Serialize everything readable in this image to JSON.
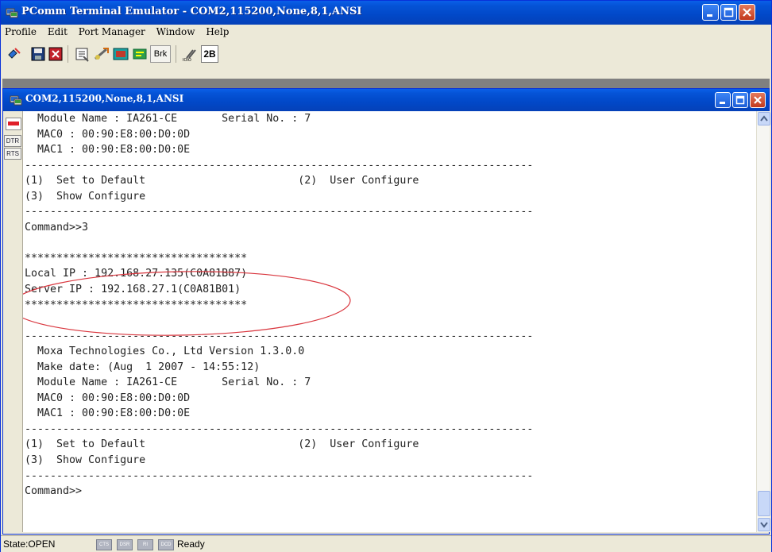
{
  "window": {
    "title": "PComm Terminal Emulator - COM2,115200,None,8,1,ANSI"
  },
  "menu": [
    "Profile",
    "Edit",
    "Port Manager",
    "Window",
    "Help"
  ],
  "toolbar": {
    "icons": [
      "connect-icon",
      "save-icon",
      "capture-icon",
      "properties-icon",
      "send-file-icon",
      "receive-file-icon",
      "scroll-icon"
    ],
    "brk_label": "Brk",
    "twob_label": "2B"
  },
  "child": {
    "title": "COM2,115200,None,8,1,ANSI"
  },
  "side": {
    "dtr_label": "DTR",
    "rts_label": "RTS"
  },
  "terminal": {
    "lines": [
      "  Module Name : IA261-CE       Serial No. : 7",
      "  MAC0 : 00:90:E8:00:D0:0D",
      "  MAC1 : 00:90:E8:00:D0:0E",
      "--------------------------------------------------------------------------------",
      "(1)  Set to Default                        (2)  User Configure",
      "(3)  Show Configure",
      "--------------------------------------------------------------------------------",
      "Command>>3",
      "",
      "***********************************",
      "Local IP : 192.168.27.135(C0A81B87)",
      "Server IP : 192.168.27.1(C0A81B01)",
      "***********************************",
      "",
      "--------------------------------------------------------------------------------",
      "  Moxa Technologies Co., Ltd Version 1.3.0.0",
      "  Make date: (Aug  1 2007 - 14:55:12)",
      "  Module Name : IA261-CE       Serial No. : 7",
      "  MAC0 : 00:90:E8:00:D0:0D",
      "  MAC1 : 00:90:E8:00:D0:0E",
      "--------------------------------------------------------------------------------",
      "(1)  Set to Default                        (2)  User Configure",
      "(3)  Show Configure",
      "--------------------------------------------------------------------------------",
      "Command>>"
    ]
  },
  "status": {
    "state": "State:OPEN",
    "indicators": [
      "CTS",
      "DSR",
      "RI",
      "DCD"
    ],
    "ready": "Ready"
  },
  "colors": {
    "title_blue": "#0553d6",
    "annotation_red": "#d9363e"
  }
}
